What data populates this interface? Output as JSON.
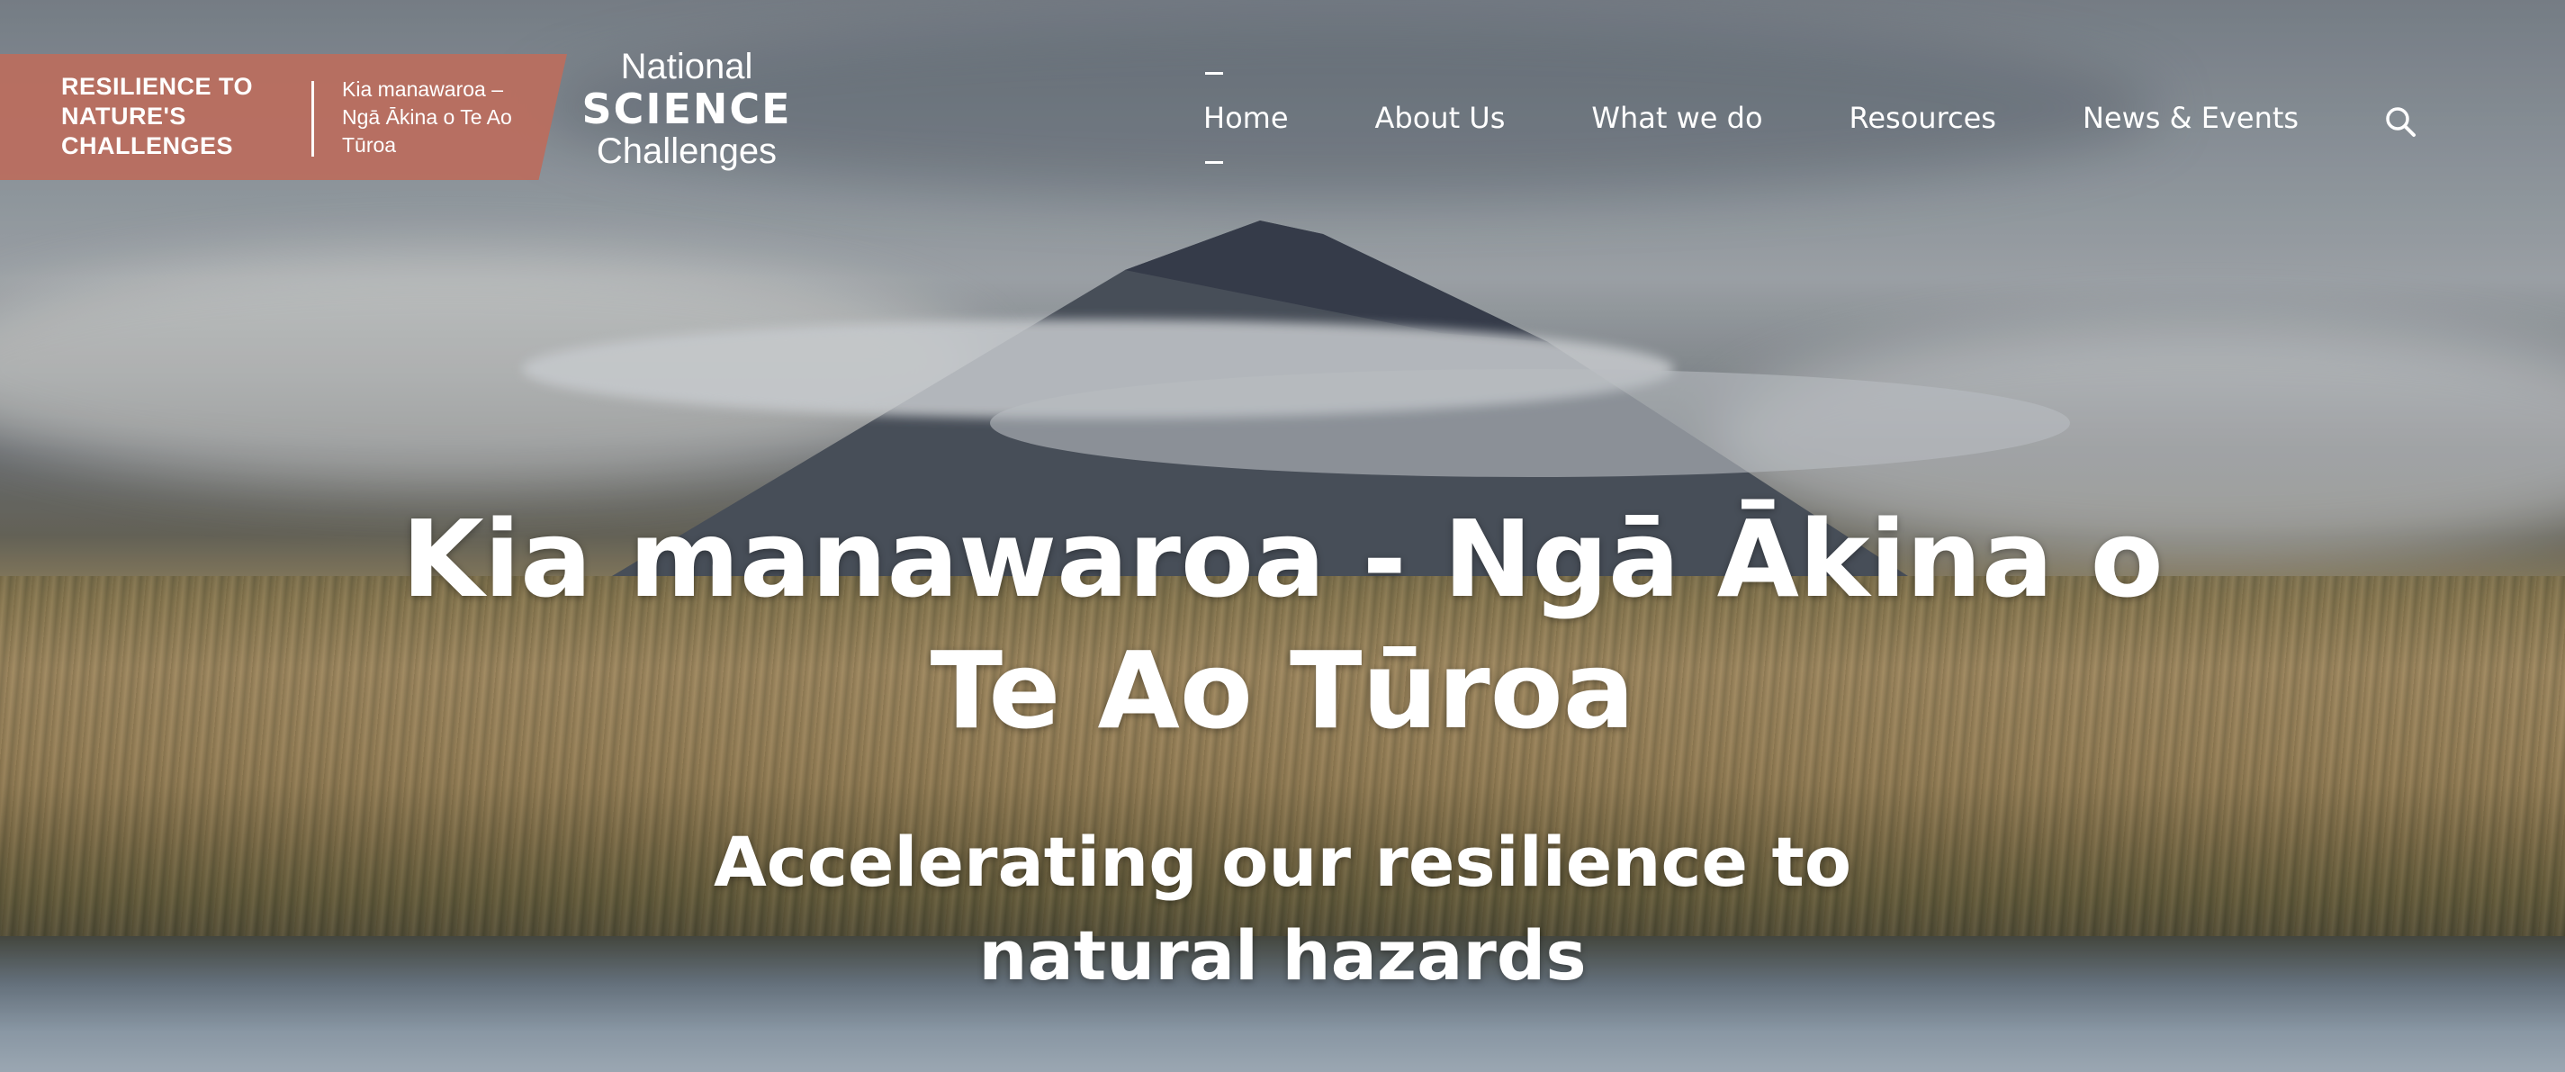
{
  "brand": {
    "challenge_title": "RESILIENCE TO NATURE'S CHALLENGES",
    "challenge_subtitle": "Kia manawaroa – Ngā Ākina o Te Ao Tūroa",
    "nsc_line1": "National",
    "nsc_line2": "SCIENCE",
    "nsc_line3": "Challenges"
  },
  "nav": {
    "items": [
      {
        "label": "Home",
        "active": true
      },
      {
        "label": "About Us"
      },
      {
        "label": "What we do"
      },
      {
        "label": "Resources"
      },
      {
        "label": "News & Events"
      }
    ],
    "search_icon": "search-icon"
  },
  "hero": {
    "title": "Kia manawaroa - Ngā Ākina o Te Ao Tūroa",
    "subtitle": "Accelerating our resilience to natural hazards"
  },
  "colors": {
    "ribbon": "#b96e5f",
    "text": "#ffffff"
  }
}
